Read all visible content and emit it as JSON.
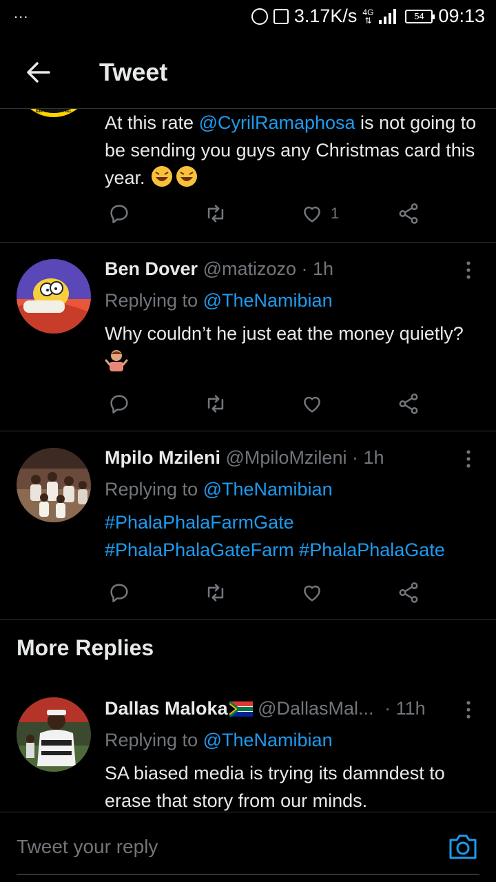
{
  "status_bar": {
    "dots": "...",
    "speed": "3.17K/s",
    "network": "4G",
    "battery": "54",
    "time": "09:13"
  },
  "header": {
    "title": "Tweet"
  },
  "partial_tweet": {
    "avatar_text": "BACK THE",
    "text_before": "At this rate ",
    "mention": "@CyrilRamaphosa",
    "text_after": " is not going to be sending you guys any Christmas card this year. ",
    "like_count": "1"
  },
  "replies": [
    {
      "name": "Ben Dover",
      "handle": "@matizozo",
      "time": "· 1h",
      "replying_label": "Replying to ",
      "replying_to": "@TheNamibian",
      "text": "Why couldn’t he just eat the money quietly? "
    },
    {
      "name": "Mpilo Mzileni",
      "handle": "@MpiloMzileni",
      "time": "· 1h",
      "replying_label": "Replying to ",
      "replying_to": "@TheNamibian",
      "hashtags": [
        "#PhalaPhalaFarmGate",
        "#PhalaPhalaGateFarm",
        "#PhalaPhalaGate"
      ]
    }
  ],
  "more_replies": {
    "title": "More Replies",
    "tweet": {
      "name": "Dallas Maloka",
      "handle": "@DallasMal...",
      "time": "· 11h",
      "replying_label": "Replying to ",
      "replying_to": "@TheNamibian",
      "text": "SA biased media is trying its damndest to erase that story from our minds."
    }
  },
  "compose": {
    "placeholder": "Tweet your reply"
  },
  "colors": {
    "background": "#000000",
    "accent": "#1d9bf0",
    "text": "#e7e9ea",
    "muted": "#71767b",
    "divider": "#2f3336"
  }
}
